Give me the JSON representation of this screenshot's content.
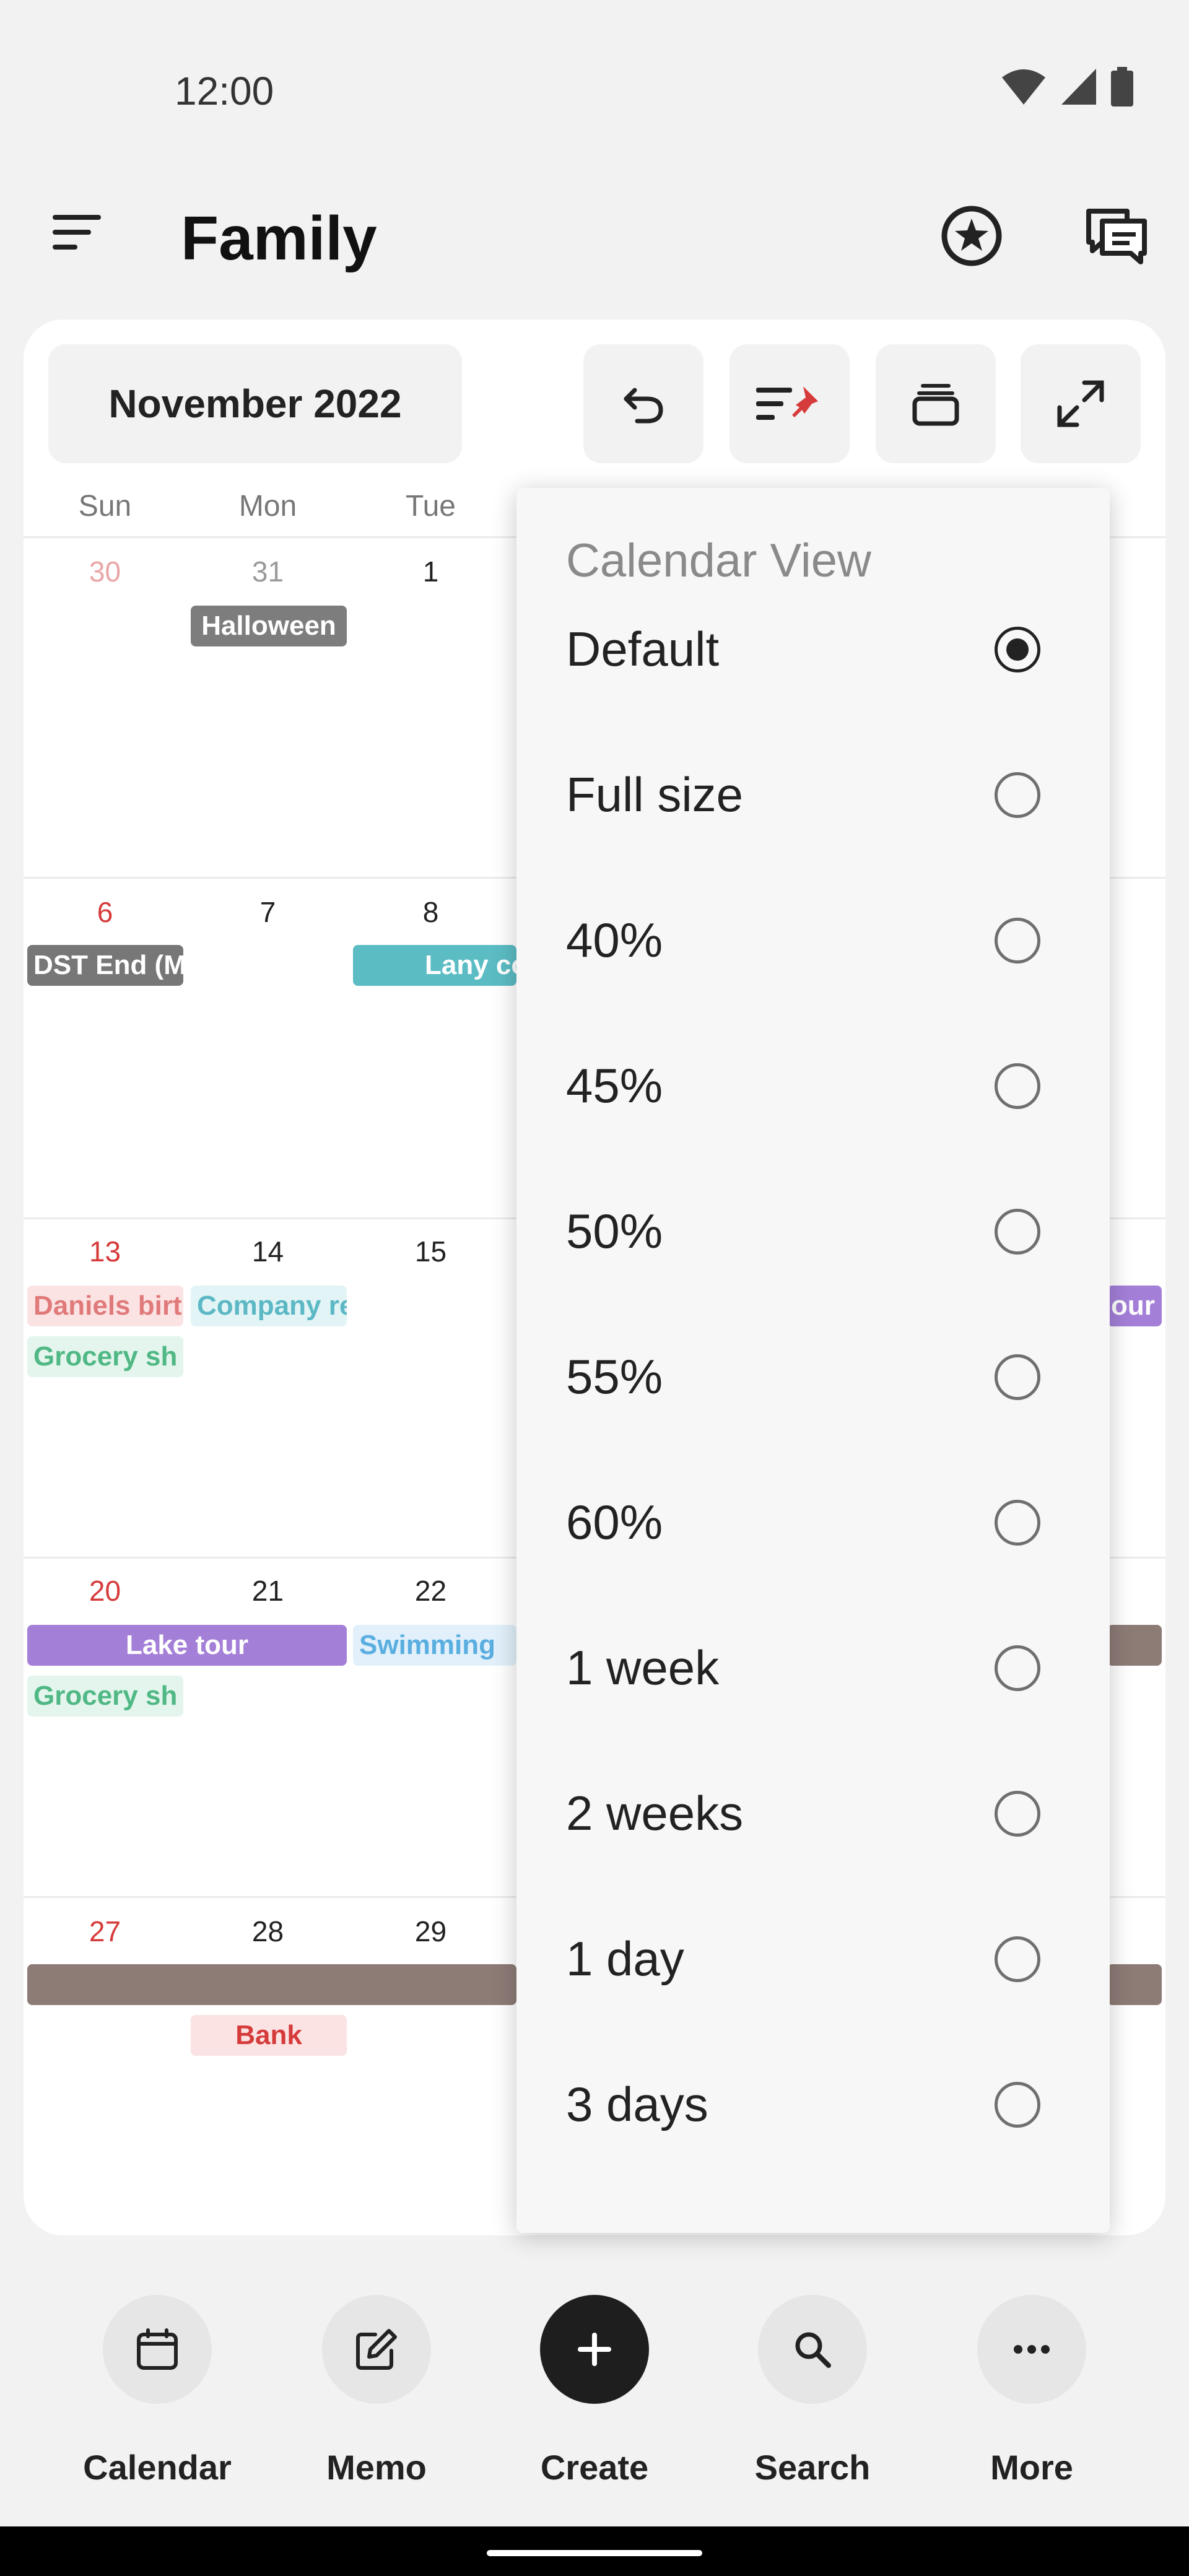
{
  "status_bar": {
    "time": "12:00"
  },
  "app_bar": {
    "title": "Family",
    "icons": [
      "menu-icon",
      "star-icon",
      "chat-icon"
    ]
  },
  "calendar": {
    "month_label": "November 2022",
    "toolbar_icons": [
      "undo-icon",
      "pin-sort-icon",
      "stack-icon",
      "expand-icon"
    ],
    "weekdays": [
      "Sun",
      "Mon",
      "Tue"
    ],
    "weeks": [
      {
        "days": [
          "30",
          "31",
          "1"
        ],
        "events": [
          {
            "label": "Halloween",
            "color": "#7d7d7d"
          }
        ]
      },
      {
        "days": [
          "6",
          "7",
          "8"
        ],
        "events": [
          {
            "label": "DST End (M",
            "color": "#777777"
          },
          {
            "label": "Lany co",
            "color": "#5bbcc4"
          }
        ]
      },
      {
        "days": [
          "13",
          "14",
          "15"
        ],
        "events": [
          {
            "label": "Daniels birt",
            "color": "#e07a7a"
          },
          {
            "label": "Company re",
            "color": "#5bb8c4"
          },
          {
            "label": "Grocery sh",
            "color": "#4fb884"
          },
          {
            "label": "our",
            "color": "#a47fd8"
          }
        ]
      },
      {
        "days": [
          "20",
          "21",
          "22"
        ],
        "events": [
          {
            "label": "Lake tour",
            "color": "#a47fd8"
          },
          {
            "label": "Swimming",
            "color": "#5aaee0"
          },
          {
            "label": "Grocery sh",
            "color": "#4fb884"
          }
        ]
      },
      {
        "days": [
          "27",
          "28",
          "29"
        ],
        "events": [
          {
            "label": "",
            "color": "#8d7b76"
          },
          {
            "label": "Bank",
            "color": "#d63b3b"
          }
        ]
      }
    ]
  },
  "menu": {
    "title": "Calendar View",
    "selected": "Default",
    "items": [
      "Default",
      "Full size",
      "40%",
      "45%",
      "50%",
      "55%",
      "60%",
      "1 week",
      "2 weeks",
      "1 day",
      "3 days"
    ]
  },
  "bottom_nav": {
    "items": [
      {
        "label": "Calendar",
        "icon": "calendar-icon"
      },
      {
        "label": "Memo",
        "icon": "edit-icon"
      },
      {
        "label": "Create",
        "icon": "plus-icon"
      },
      {
        "label": "Search",
        "icon": "search-icon"
      },
      {
        "label": "More",
        "icon": "more-icon"
      }
    ]
  }
}
